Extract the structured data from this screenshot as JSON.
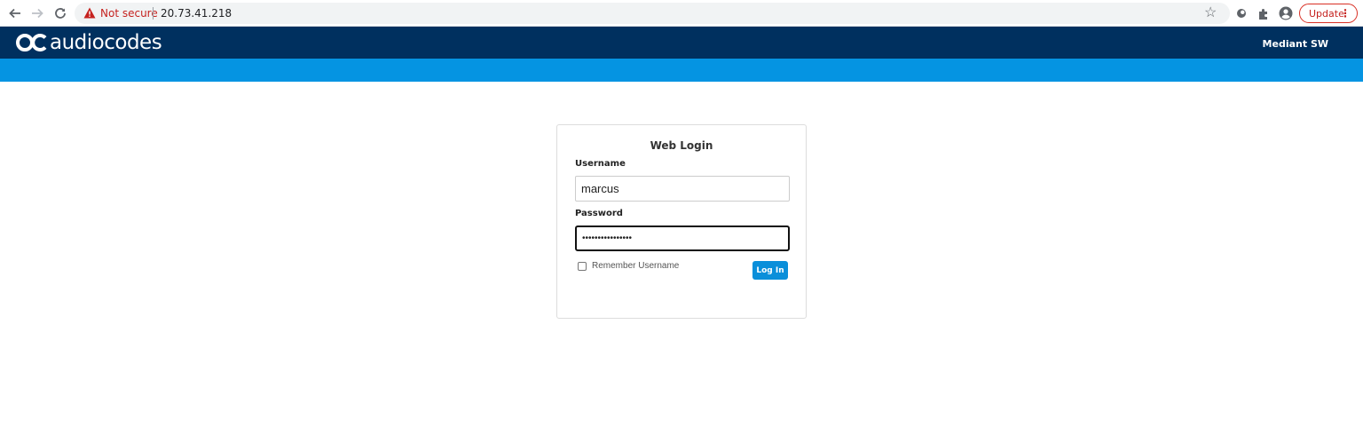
{
  "browser": {
    "security_label": "Not secure",
    "url": "20.73.41.218",
    "update_label": "Update",
    "menu_glyph": "⋮"
  },
  "header": {
    "logo_text": "audiocodes",
    "product_name": "Mediant SW"
  },
  "login": {
    "title": "Web Login",
    "username_label": "Username",
    "username_value": "marcus",
    "password_label": "Password",
    "password_masked": "••••••••••••••••",
    "remember_label": "Remember Username",
    "remember_checked": false,
    "submit_label": "Log In"
  },
  "colors": {
    "header_dark": "#00305f",
    "header_blue": "#0594e2",
    "button_blue": "#0a8fda",
    "warning_red": "#c5221f"
  }
}
